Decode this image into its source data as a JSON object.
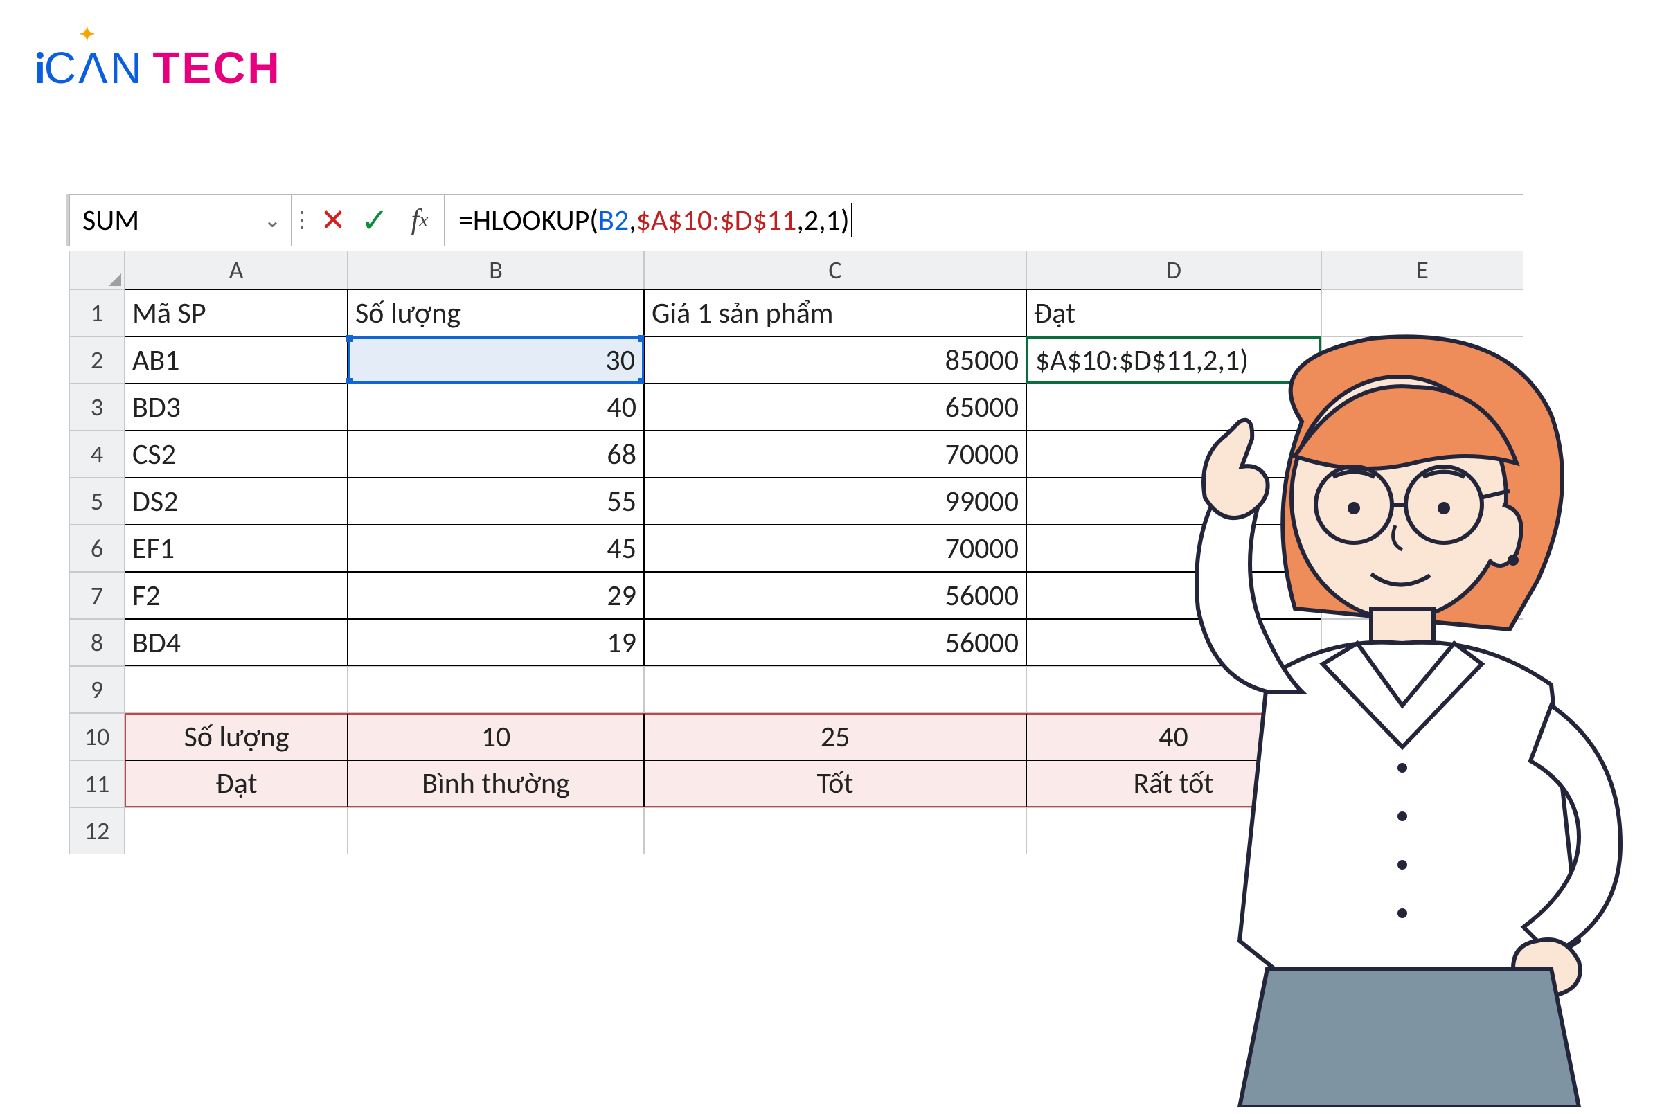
{
  "logo": {
    "i": "i",
    "can": "CΛN",
    "tech": "TECH"
  },
  "formula_bar": {
    "name_box": "SUM",
    "formula_prefix": "=HLOOKUP(",
    "b2": "B2",
    "comma1": ",",
    "range": "$A$10:$D$11",
    "rest": ",2,1)"
  },
  "col_headers": [
    "A",
    "B",
    "C",
    "D",
    "E"
  ],
  "row_headers": [
    "1",
    "2",
    "3",
    "4",
    "5",
    "6",
    "7",
    "8",
    "9",
    "10",
    "11",
    "12"
  ],
  "table_header": {
    "a": "Mã SP",
    "b": "Số lượng",
    "c": "Giá 1 sản phẩm",
    "d": "Đạt"
  },
  "rows": [
    {
      "a": "AB1",
      "b": "30",
      "c": "85000",
      "d": "$A$10:$D$11,2,1)"
    },
    {
      "a": "BD3",
      "b": "40",
      "c": "65000",
      "d": ""
    },
    {
      "a": "CS2",
      "b": "68",
      "c": "70000",
      "d": ""
    },
    {
      "a": "DS2",
      "b": "55",
      "c": "99000",
      "d": ""
    },
    {
      "a": "EF1",
      "b": "45",
      "c": "70000",
      "d": ""
    },
    {
      "a": "F2",
      "b": "29",
      "c": "56000",
      "d": ""
    },
    {
      "a": "BD4",
      "b": "19",
      "c": "56000",
      "d": ""
    }
  ],
  "lookup_table": [
    {
      "a": "Số lượng",
      "b": "10",
      "c": "25",
      "d": "40"
    },
    {
      "a": "Đạt",
      "b": "Bình thường",
      "c": "Tốt",
      "d": "Rất tốt"
    }
  ]
}
